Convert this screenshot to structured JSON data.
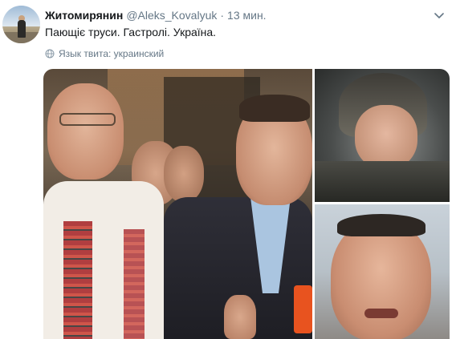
{
  "tweet": {
    "author_name": "Житомирянин",
    "handle": "@Aleks_Kovalyuk",
    "separator": "·",
    "time": "13 мин.",
    "text": "Пающіє труси. Гастролі. Україна.",
    "language_note": "Язык твита: украинский"
  },
  "icons": {
    "avatar": "user-avatar",
    "caret": "chevron-down-icon",
    "globe": "globe-icon"
  },
  "colors": {
    "name": "#14171a",
    "secondary": "#657786",
    "background": "#ffffff"
  },
  "media": {
    "count": 3
  }
}
